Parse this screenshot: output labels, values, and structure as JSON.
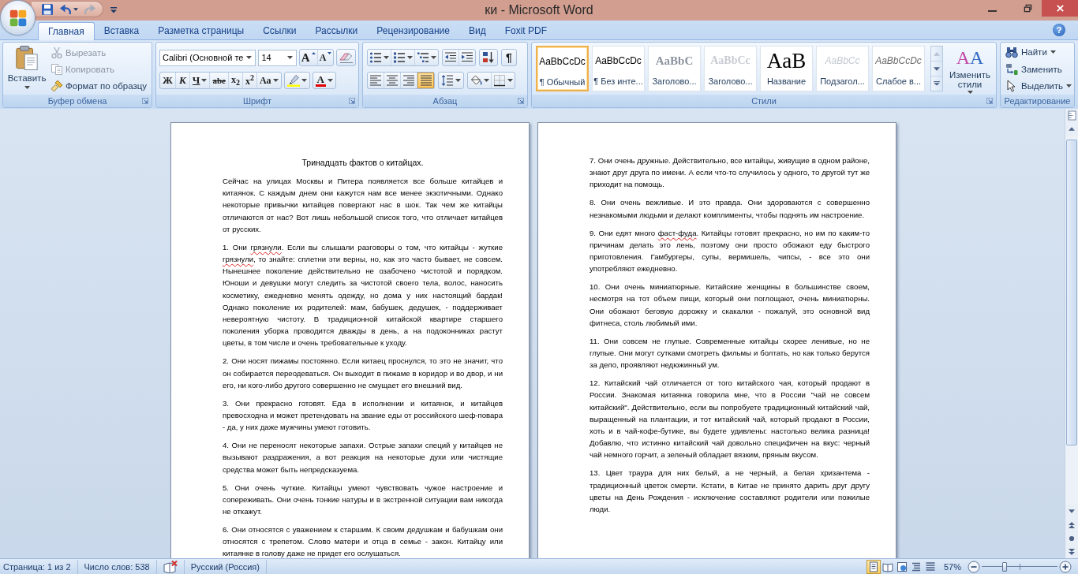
{
  "window": {
    "title": "ки - Microsoft Word",
    "help": "?"
  },
  "quick_access": [
    {
      "kind": "save",
      "disabled": false
    },
    {
      "kind": "undo",
      "disabled": false
    },
    {
      "kind": "redo",
      "disabled": true
    }
  ],
  "tabs": [
    {
      "label": "Главная",
      "selected": true
    },
    {
      "label": "Вставка",
      "selected": false
    },
    {
      "label": "Разметка страницы",
      "selected": false
    },
    {
      "label": "Ссылки",
      "selected": false
    },
    {
      "label": "Рассылки",
      "selected": false
    },
    {
      "label": "Рецензирование",
      "selected": false
    },
    {
      "label": "Вид",
      "selected": false
    },
    {
      "label": "Foxit PDF",
      "selected": false
    }
  ],
  "clipboard": {
    "title": "Буфер обмена",
    "paste": "Вставить",
    "items": [
      {
        "kind": "cut",
        "label": "Вырезать",
        "disabled": true
      },
      {
        "kind": "copy",
        "label": "Копировать",
        "disabled": true
      },
      {
        "kind": "format_painter",
        "label": "Формат по образцу",
        "disabled": false
      }
    ]
  },
  "font": {
    "title": "Шрифт",
    "font_name": "Calibri (Основной те",
    "font_size": "14",
    "size_buttons": [
      {
        "kind": "grow",
        "label": "A"
      },
      {
        "kind": "shrink",
        "label": "A"
      }
    ],
    "format_buttons": [
      {
        "kind": "bold",
        "label": "Ж"
      },
      {
        "kind": "italic",
        "label": "К"
      },
      {
        "kind": "underline",
        "label": "Ч"
      },
      {
        "kind": "strikethrough",
        "label": "abe"
      },
      {
        "kind": "subscript",
        "label": "x$_{2}$"
      },
      {
        "kind": "superscript",
        "label": "x$^{2}$"
      },
      {
        "kind": "case",
        "label": "Aa"
      }
    ],
    "font_color": "A"
  },
  "paragraph": {
    "title": "Абзац",
    "show_marks": "¶",
    "alignment": [
      {
        "kind": "left",
        "selected": false
      },
      {
        "kind": "center",
        "selected": false
      },
      {
        "kind": "right",
        "selected": false
      },
      {
        "kind": "justify",
        "selected": true
      }
    ]
  },
  "styles": {
    "title": "Стили",
    "gallery": [
      {
        "kind": "normal",
        "preview": "AaBbCcDc",
        "name": "¶ Обычный",
        "selected": true
      },
      {
        "kind": "normal",
        "preview": "AaBbCcDc",
        "name": "¶ Без инте...",
        "selected": false
      },
      {
        "kind": "heading_1",
        "preview": "AaBbC",
        "name": "Заголово...",
        "selected": false
      },
      {
        "kind": "heading_2",
        "preview": "AaBbCc",
        "name": "Заголово...",
        "selected": false
      },
      {
        "kind": "title",
        "preview": "AaB",
        "name": "Название",
        "selected": false
      },
      {
        "kind": "subtitle",
        "preview": "AaBbCc",
        "name": "Подзагол...",
        "selected": false
      },
      {
        "kind": "emphasis",
        "preview": "AaBbCcDc",
        "name": "Слабое в...",
        "selected": false
      }
    ],
    "change_styles": {
      "glyph": "AA",
      "label": "Изменить стили"
    }
  },
  "editing": {
    "title": "Редактирование",
    "items": [
      {
        "kind": "find",
        "label": "Найти"
      },
      {
        "kind": "replace",
        "label": "Заменить"
      },
      {
        "kind": "select",
        "label": "Выделить"
      }
    ]
  },
  "document": {
    "pages": [
      {
        "title": "Тринадцать фактов о китайцах.",
        "paragraphs": [
          {
            "runs": [
              {
                "text": "Сейчас на улицах Москвы и Питера появляется все больше китайцев и китаянок. С каждым днем они кажутся нам все менее экзотичными. Однако некоторые привычки китайцев повергают нас в шок. Так чем же китайцы отличаются от нас? Вот лишь небольшой список того, что отличает китайцев от русских.",
                "misspelled": false
              }
            ]
          },
          {
            "runs": [
              {
                "text": "1. Они ",
                "misspelled": false
              },
              {
                "text": "грязнули",
                "misspelled": true
              },
              {
                "text": ". Если вы слышали разговоры о том, что китайцы - жуткие ",
                "misspelled": false
              },
              {
                "text": "грязнули",
                "misspelled": true
              },
              {
                "text": ", то знайте: сплетни эти верны, но, как это часто бывает, не совсем. Нынешнее поколение действительно не озабочено чистотой и порядком. Юноши и девушки могут следить за чистотой своего тела, волос, наносить косметику, ежедневно менять одежду, но дома у них настоящий бардак! Однако поколение их родителей: мам, бабушек, дедушек, - поддерживает невероятную чистоту. В традиционной китайской квартире старшего поколения уборка проводится дважды в день, а на подоконниках растут цветы, в том числе и очень требовательные к уходу.",
                "misspelled": false
              }
            ]
          },
          {
            "runs": [
              {
                "text": "2. Они носят пижамы постоянно. Если китаец проснулся, то это не значит, что он собирается переодеваться. Он выходит в пижаме в коридор и во двор, и ни его, ни кого-либо другого совершенно не смущает его внешний вид.",
                "misspelled": false
              }
            ]
          },
          {
            "runs": [
              {
                "text": "3. Они прекрасно готовят. Еда в исполнении и китаянок, и китайцев превосходна и может претендовать на звание еды от российского шеф-повара - да, у них даже мужчины умеют готовить.",
                "misspelled": false
              }
            ]
          },
          {
            "runs": [
              {
                "text": "4. Они не переносят некоторые запахи. Острые запахи специй у китайцев не вызывают раздражения, а вот реакция на некоторые духи или чистящие средства может быть непредсказуема.",
                "misspelled": false
              }
            ]
          },
          {
            "runs": [
              {
                "text": "5. Они очень чуткие. Китайцы умеют чувствовать чужое настроение и сопереживать. Они очень тонкие натуры и в экстренной ситуации вам никогда не откажут.",
                "misspelled": false
              }
            ]
          },
          {
            "runs": [
              {
                "text": "6. Они относятся с уважением к старшим. К своим дедушкам и бабушкам они относятся с трепетом. Слово матери и отца в семье - закон. Китайцу или китаянке в голову даже не придет его ослушаться.",
                "misspelled": false
              }
            ]
          }
        ]
      },
      {
        "paragraphs": [
          {
            "runs": [
              {
                "text": "7. Они очень дружные. Действительно, все китайцы, живущие в одном районе, знают друг друга по имени. А если что-то случилось у одного, то другой тут же приходит на помощь.",
                "misspelled": false
              }
            ]
          },
          {
            "runs": [
              {
                "text": "8. Они очень вежливые. И это правда. Они здороваются с совершенно незнакомыми людьми и делают комплименты, чтобы поднять им настроение.",
                "misspelled": false
              }
            ]
          },
          {
            "runs": [
              {
                "text": "9. Они едят много ",
                "misspelled": false
              },
              {
                "text": "фаст-фуда",
                "misspelled": true
              },
              {
                "text": ". Китайцы готовят прекрасно, но им по каким-то причинам делать это лень, поэтому они просто обожают еду быстрого приготовления. Гамбургеры, супы, вермишель, чипсы, - все это они употребляют ежедневно.",
                "misspelled": false
              }
            ]
          },
          {
            "runs": [
              {
                "text": "10. Они очень миниатюрные. Китайские женщины в большинстве своем, несмотря на тот объем пищи, который они поглощают, очень миниатюрны. Они обожают беговую дорожку и скакалки - пожалуй, это основной вид фитнеса, столь любимый ими.",
                "misspelled": false
              }
            ]
          },
          {
            "runs": [
              {
                "text": "11. Они совсем не глупые. Современные китайцы скорее ленивые, но не глупые. Они могут сутками смотреть фильмы и болтать, но как только берутся за дело, проявляют недюжинный ум.",
                "misspelled": false
              }
            ]
          },
          {
            "runs": [
              {
                "text": "12. Китайский чай отличается от того китайского чая, который продают в России. Знакомая китаянка говорила мне, что в России \"чай не совсем китайский\". Действительно, если вы попробуете традиционный китайский чай, выращенный на плантации, и тот китайский чай, который продают в России, хоть и в чай-кофе-бутике, вы будете удивлены: настолько велика разница! Добавлю, что истинно китайский чай довольно специфичен на вкус: черный чай немного горчит, а зеленый обладает вязким, пряным вкусом.",
                "misspelled": false
              }
            ]
          },
          {
            "runs": [
              {
                "text": "13. Цвет траура для них белый, а не черный, а белая хризантема - традиционный цветок смерти. Кстати, в Китае не принято дарить друг другу цветы на День Рождения - исключение составляют родители или пожилые люди.",
                "misspelled": false
              }
            ]
          }
        ]
      }
    ]
  },
  "status_bar": {
    "page": "Страница: 1 из 2",
    "words": "Число слов: 538",
    "language": "Русский (Россия)",
    "views": [
      {
        "kind": "print_layout",
        "selected": true
      },
      {
        "kind": "full_screen",
        "selected": false
      },
      {
        "kind": "web",
        "selected": false
      },
      {
        "kind": "outline",
        "selected": false
      },
      {
        "kind": "draft",
        "selected": false
      }
    ],
    "zoom": {
      "reading": "57%",
      "level": 0.3
    }
  }
}
